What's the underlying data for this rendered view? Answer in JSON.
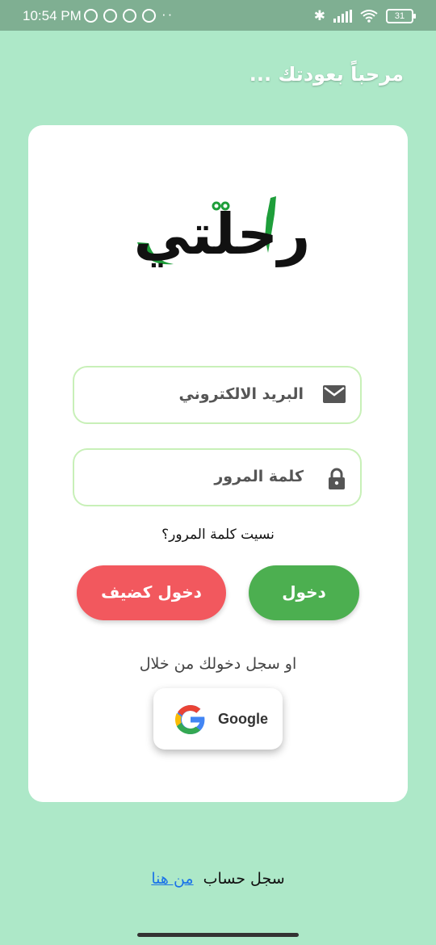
{
  "status_bar": {
    "time": "10:54 PM",
    "battery": "31"
  },
  "header": {
    "welcome": "مرحباً بعودتك ..."
  },
  "logo": {
    "text": "رحلتي"
  },
  "form": {
    "email_label": "البريد الالكتروني",
    "password_label": "كلمة المرور",
    "forgot_password": "نسيت كلمة المرور؟",
    "login_button": "دخول",
    "guest_button": "دخول كضيف",
    "or_register_with": "او سجل دخولك من خلال",
    "google_button": "Google"
  },
  "footer": {
    "register_text": "سجل حساب",
    "register_link": "من هنا"
  },
  "colors": {
    "background": "#ade8c8",
    "login": "#4caf50",
    "guest": "#f2585e",
    "field_border": "#c8f0b8"
  }
}
